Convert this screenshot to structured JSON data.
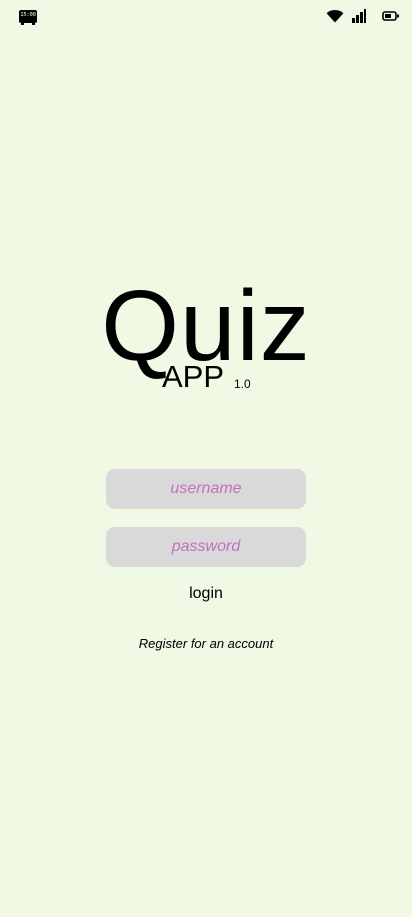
{
  "status_bar": {
    "time": "15:00",
    "icons": [
      "wifi-icon",
      "signal-icon",
      "battery-icon"
    ]
  },
  "header": {
    "title": "Quiz",
    "subtitle": "APP",
    "version": "1.0"
  },
  "login_form": {
    "username_placeholder": "username",
    "username_value": "",
    "password_placeholder": "password",
    "password_value": "",
    "login_label": "login",
    "register_label": "Register for an account"
  },
  "colors": {
    "background": "#eff9e4",
    "field_background": "#d9d9d9",
    "placeholder": "#c46fbe",
    "text": "#000000"
  }
}
